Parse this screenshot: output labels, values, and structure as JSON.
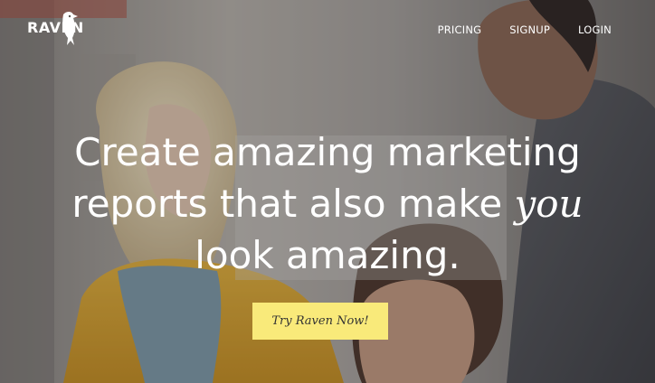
{
  "brand": {
    "name": "RAVEN"
  },
  "nav": {
    "links": [
      "PRICING",
      "SIGNUP",
      "LOGIN"
    ]
  },
  "hero": {
    "headline_line1": "Create amazing marketing",
    "headline_line2_a": "reports that also make ",
    "headline_line2_em": "you",
    "headline_line3": "look amazing.",
    "cta_label": "Try Raven Now!"
  },
  "colors": {
    "cta_background": "#f9ea7a",
    "text": "#ffffff"
  },
  "icons": {
    "logo": "raven-bird-icon"
  }
}
